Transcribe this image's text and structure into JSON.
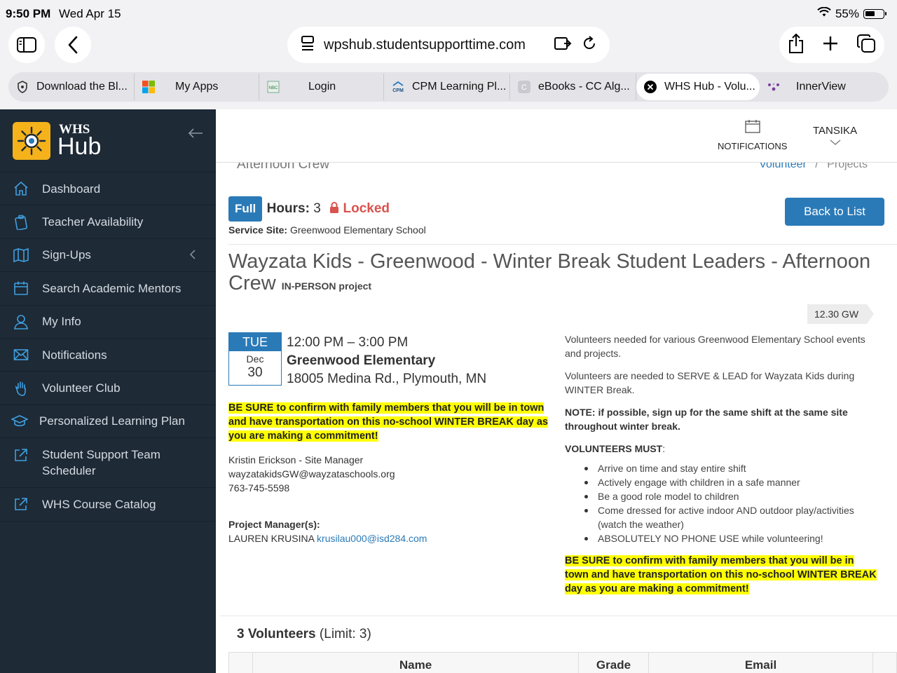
{
  "status": {
    "time": "9:50 PM",
    "date": "Wed Apr 15",
    "battery": "55%"
  },
  "browser": {
    "url": "wpshub.studentsupporttime.com",
    "tabs": [
      {
        "label": "Download the Bl...",
        "icon": "shield-icon"
      },
      {
        "label": "My Apps",
        "icon": "microsoft-icon"
      },
      {
        "label": "Login",
        "icon": "nbc-icon"
      },
      {
        "label": "CPM Learning Pl...",
        "icon": "cpm-icon"
      },
      {
        "label": "eBooks - CC Alg...",
        "icon": "c-icon"
      },
      {
        "label": "WHS Hub - Volu...",
        "icon": "close-icon",
        "active": true
      },
      {
        "label": "InnerView",
        "icon": "innerview-icon"
      }
    ]
  },
  "brand": {
    "line1": "WHS",
    "line2": "Hub"
  },
  "sidebar": {
    "items": [
      {
        "label": "Dashboard",
        "icon": "home-icon"
      },
      {
        "label": "Teacher Availability",
        "icon": "clipboard-icon"
      },
      {
        "label": "Sign-Ups",
        "icon": "map-icon"
      },
      {
        "label": "Search Academic Mentors",
        "icon": "calendar-icon"
      },
      {
        "label": "My Info",
        "icon": "user-icon"
      },
      {
        "label": "Notifications",
        "icon": "envelope-icon"
      },
      {
        "label": "Volunteer Club",
        "icon": "hand-icon"
      },
      {
        "label": "Personalized Learning Plan",
        "icon": "graduation-cap-icon"
      },
      {
        "label": "Student Support Team Scheduler",
        "icon": "external-link-icon"
      },
      {
        "label": "WHS Course Catalog",
        "icon": "external-link-icon"
      }
    ]
  },
  "topnav": {
    "notifications": "NOTIFICATIONS",
    "user": "TANSIKA"
  },
  "breadcrumb": {
    "page_title": "Afternoon Crew",
    "link": "Volunteer",
    "sep": "/",
    "current": "Projects"
  },
  "project": {
    "badge": "Full",
    "hours_label": "Hours:",
    "hours_value": "3",
    "locked": "Locked",
    "site_label": "Service Site:",
    "site_value": "Greenwood Elementary School",
    "back_button": "Back to List",
    "title": "Wayzata Kids - Greenwood - Winter Break Student Leaders - Afternoon Crew",
    "type": "IN-PERSON project",
    "tag": "12.30 GW",
    "date": {
      "dow": "TUE",
      "month": "Dec",
      "day": "30"
    },
    "time_range": "12:00 PM – 3:00 PM",
    "location": "Greenwood Elementary",
    "address": "18005 Medina Rd., Plymouth, MN",
    "warning": "BE SURE to confirm with family members that you will be in town and have transportation on this no-school WINTER BREAK day as you are making a commitment!",
    "contact": {
      "name": "Kristin Erickson - Site Manager",
      "email": "wayzatakidsGW@wayzataschools.org",
      "phone": "763-745-5598"
    },
    "pm_label": "Project Manager(s):",
    "pm_name": "LAUREN KRUSINA",
    "pm_email": "krusilau000@isd284.com"
  },
  "description": {
    "p1": "Volunteers needed for various Greenwood Elementary School events and projects.",
    "p2": "Volunteers are needed to SERVE & LEAD for Wayzata Kids during WINTER Break.",
    "note": "NOTE: if possible, sign up for the same shift at the same site throughout winter break.",
    "must_label": "VOLUNTEERS MUST",
    "must_colon": ":",
    "rules": [
      "Arrive on time and stay entire shift",
      "Actively engage with children in a safe manner",
      "Be a good role model to children",
      "Come dressed for active indoor AND outdoor play/activities (watch the weather)",
      "ABSOLUTELY NO PHONE USE while volunteering!"
    ],
    "warning": "BE SURE to confirm with family members that you will be in town and have transportation on this no-school WINTER BREAK day as you are making a commitment!"
  },
  "volunteers": {
    "count_label": "3 Volunteers",
    "limit": "(Limit: 3)",
    "columns": [
      "Name",
      "Grade",
      "Email"
    ]
  }
}
